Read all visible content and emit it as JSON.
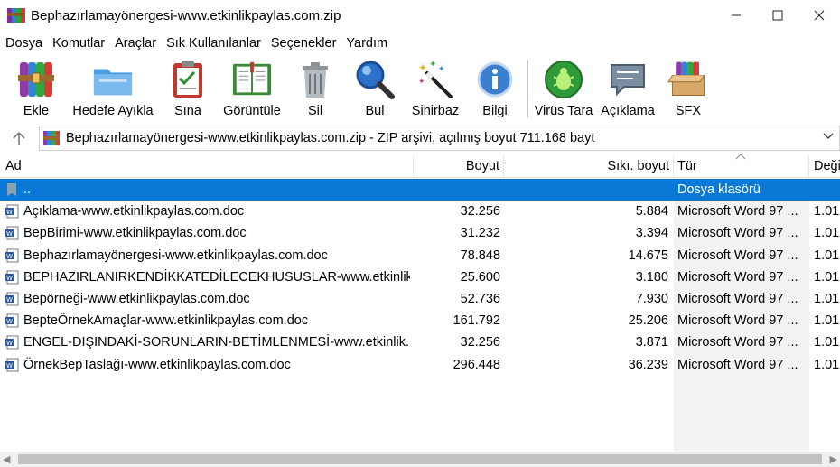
{
  "window": {
    "title": "Bephazırlamayönergesi-www.etkinlikpaylas.com.zip",
    "minimize": "—",
    "maximize": "☐",
    "close": "✕"
  },
  "menu": [
    "Dosya",
    "Komutlar",
    "Araçlar",
    "Sık Kullanılanlar",
    "Seçenekler",
    "Yardım"
  ],
  "toolbar": [
    {
      "label": "Ekle",
      "icon": "add-archive-icon"
    },
    {
      "label": "Hedefe Ayıkla",
      "icon": "extract-folder-icon"
    },
    {
      "label": "Sına",
      "icon": "test-clipboard-icon"
    },
    {
      "label": "Görüntüle",
      "icon": "view-book-icon"
    },
    {
      "label": "Sil",
      "icon": "trash-icon"
    },
    {
      "label": "Bul",
      "icon": "magnifier-icon"
    },
    {
      "label": "Sihirbaz",
      "icon": "wizard-wand-icon"
    },
    {
      "label": "Bilgi",
      "icon": "info-icon"
    },
    {
      "label": "Virüs Tara",
      "icon": "virus-scan-icon"
    },
    {
      "label": "Açıklama",
      "icon": "comment-icon"
    },
    {
      "label": "SFX",
      "icon": "sfx-box-icon"
    }
  ],
  "address": {
    "text": "Bephazırlamayönergesi-www.etkinlikpaylas.com.zip - ZIP arşivi, açılmış boyut 711.168 bayt"
  },
  "columns": {
    "name": "Ad",
    "size": "Boyut",
    "packed": "Sıkı. boyut",
    "type": "Tür",
    "modified": "Deği"
  },
  "parent_row": {
    "name": "..",
    "type": "Dosya klasörü"
  },
  "files": [
    {
      "name": "Açıklama-www.etkinlikpaylas.com.doc",
      "size": "32.256",
      "packed": "5.884",
      "type": "Microsoft Word 97 ...",
      "modified": "1.01"
    },
    {
      "name": "BepBirimi-www.etkinlikpaylas.com.doc",
      "size": "31.232",
      "packed": "3.394",
      "type": "Microsoft Word 97 ...",
      "modified": "1.01"
    },
    {
      "name": "Bephazırlamayönergesi-www.etkinlikpaylas.com.doc",
      "size": "78.848",
      "packed": "14.675",
      "type": "Microsoft Word 97 ...",
      "modified": "1.01"
    },
    {
      "name": "BEPHAZIRLANIRKENDİKKATEDİLECEKHUSUSLAR-www.etkinlikp...",
      "size": "25.600",
      "packed": "3.180",
      "type": "Microsoft Word 97 ...",
      "modified": "1.01"
    },
    {
      "name": "Bepörneği-www.etkinlikpaylas.com.doc",
      "size": "52.736",
      "packed": "7.930",
      "type": "Microsoft Word 97 ...",
      "modified": "1.01"
    },
    {
      "name": "BepteÖrnekAmaçlar-www.etkinlikpaylas.com.doc",
      "size": "161.792",
      "packed": "25.206",
      "type": "Microsoft Word 97 ...",
      "modified": "1.01"
    },
    {
      "name": "ENGEL-DIŞINDAKİ-SORUNLARIN-BETİMLENMESİ-www.etkinlik...",
      "size": "32.256",
      "packed": "3.871",
      "type": "Microsoft Word 97 ...",
      "modified": "1.01"
    },
    {
      "name": "ÖrnekBepTaslağı-www.etkinlikpaylas.com.doc",
      "size": "296.448",
      "packed": "36.239",
      "type": "Microsoft Word 97 ...",
      "modified": "1.01"
    }
  ],
  "colors": {
    "selection": "#0a78d7",
    "word_icon": "#2b579a"
  }
}
